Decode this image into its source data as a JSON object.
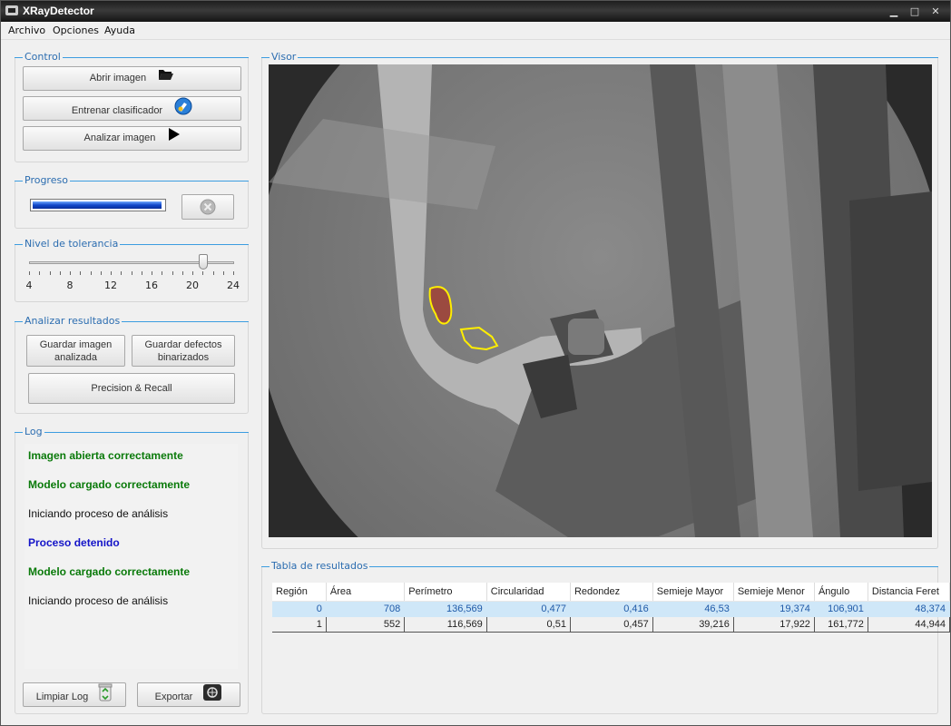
{
  "window": {
    "title": "XRayDetector"
  },
  "menu": [
    "Archivo",
    "Opciones",
    "Ayuda"
  ],
  "control": {
    "title": "Control",
    "open_label": "Abrir imagen",
    "train_label": "Entrenar clasificador",
    "analyze_label": "Analizar imagen"
  },
  "progress": {
    "title": "Progreso",
    "value": 1.0
  },
  "tolerance": {
    "title": "Nivel de tolerancia",
    "ticks": [
      "4",
      "8",
      "12",
      "16",
      "20",
      "24"
    ],
    "min": 4,
    "max": 24,
    "value": 21
  },
  "results_actions": {
    "title": "Analizar resultados",
    "save_image_line1": "Guardar imagen",
    "save_image_line2": "analizada",
    "save_defects_line1": "Guardar defectos",
    "save_defects_line2": "binarizados",
    "precision_label": "Precision & Recall"
  },
  "log": {
    "title": "Log",
    "entries": [
      {
        "text": "Imagen abierta correctamente",
        "color": "#0a7a0a",
        "bold": true
      },
      {
        "text": "Modelo cargado correctamente",
        "color": "#0a7a0a",
        "bold": true
      },
      {
        "text": "Iniciando proceso de análisis",
        "color": "#111111",
        "bold": false
      },
      {
        "text": "Proceso detenido",
        "color": "#1414c8",
        "bold": true
      },
      {
        "text": "Modelo cargado correctamente",
        "color": "#0a7a0a",
        "bold": true
      },
      {
        "text": "Iniciando proceso de análisis",
        "color": "#111111",
        "bold": false
      }
    ],
    "clear_label": "Limpiar Log",
    "export_label": "Exportar"
  },
  "viewer": {
    "title": "Visor"
  },
  "table": {
    "title": "Tabla de resultados",
    "columns": [
      "Región",
      "Área",
      "Perímetro",
      "Circularidad",
      "Redondez",
      "Semieje Mayor",
      "Semieje Menor",
      "Ángulo",
      "Distancia Feret"
    ],
    "rows": [
      [
        "0",
        "708",
        "136,569",
        "0,477",
        "0,416",
        "46,53",
        "19,374",
        "106,901",
        "48,374"
      ],
      [
        "1",
        "552",
        "116,569",
        "0,51",
        "0,457",
        "39,216",
        "17,922",
        "161,772",
        "44,944"
      ]
    ],
    "selected_row": 0
  }
}
